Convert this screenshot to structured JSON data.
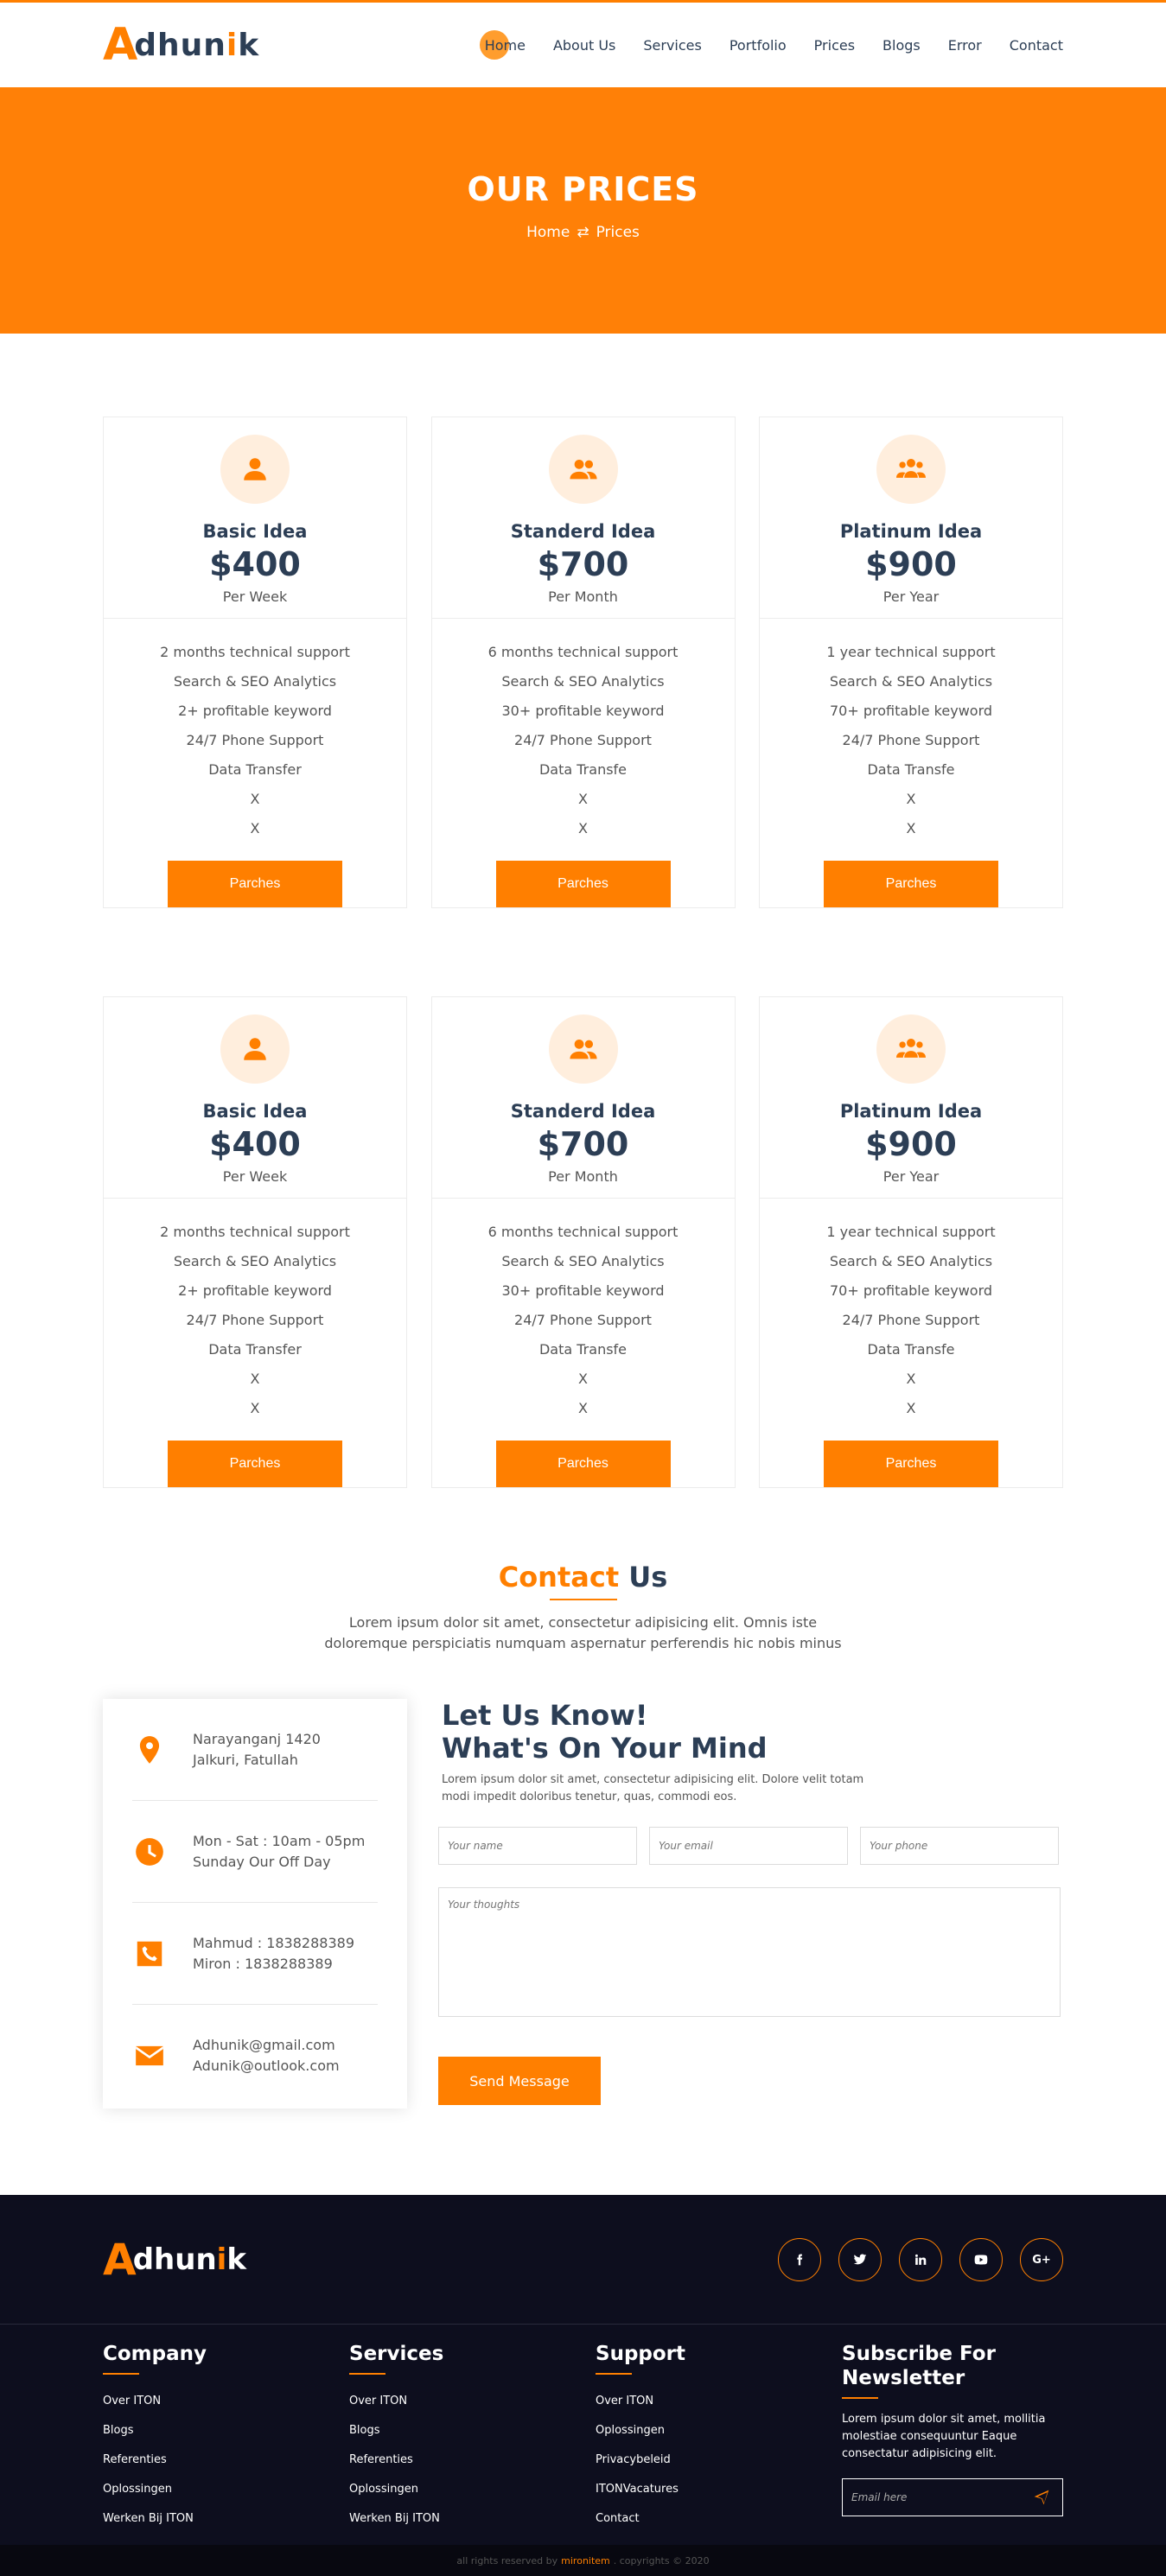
{
  "brand": {
    "first": "A",
    "middle": "dhun",
    "accent": "i",
    "last": "k"
  },
  "nav": [
    "Home",
    "About Us",
    "Services",
    "Portfolio",
    "Prices",
    "Blogs",
    "Error",
    "Contact"
  ],
  "hero": {
    "title": "OUR PRICES",
    "crumb_home": "Home",
    "crumb_sep": "⇄",
    "crumb_current": "Prices"
  },
  "pricing_rows": [
    [
      {
        "name": "Basic Idea",
        "price": "$400",
        "period": "Per Week",
        "icon": "user-icon",
        "features": [
          "2 months technical support",
          "Search & SEO Analytics",
          "2+ profitable keyword",
          "24/7 Phone Support",
          "Data Transfer",
          "X",
          "X"
        ],
        "button": "Parches"
      },
      {
        "name": "Standerd Idea",
        "price": "$700",
        "period": "Per Month",
        "icon": "users-icon",
        "features": [
          "6 months technical support",
          "Search & SEO Analytics",
          "30+ profitable keyword",
          "24/7 Phone Support",
          "Data Transfe",
          "X",
          "X"
        ],
        "button": "Parches"
      },
      {
        "name": "Platinum Idea",
        "price": "$900",
        "period": "Per Year",
        "icon": "group-icon",
        "features": [
          "1 year technical support",
          "Search & SEO Analytics",
          "70+ profitable keyword",
          "24/7 Phone Support",
          "Data Transfe",
          "X",
          "X"
        ],
        "button": "Parches"
      }
    ],
    [
      {
        "name": "Basic Idea",
        "price": "$400",
        "period": "Per Week",
        "icon": "user-icon",
        "features": [
          "2 months technical support",
          "Search & SEO Analytics",
          "2+ profitable keyword",
          "24/7 Phone Support",
          "Data Transfer",
          "X",
          "X"
        ],
        "button": "Parches"
      },
      {
        "name": "Standerd Idea",
        "price": "$700",
        "period": "Per Month",
        "icon": "users-icon",
        "features": [
          "6 months technical support",
          "Search & SEO Analytics",
          "30+ profitable keyword",
          "24/7 Phone Support",
          "Data Transfe",
          "X",
          "X"
        ],
        "button": "Parches"
      },
      {
        "name": "Platinum Idea",
        "price": "$900",
        "period": "Per Year",
        "icon": "group-icon",
        "features": [
          "1 year technical support",
          "Search & SEO Analytics",
          "70+ profitable keyword",
          "24/7 Phone Support",
          "Data Transfe",
          "X",
          "X"
        ],
        "button": "Parches"
      }
    ]
  ],
  "contact": {
    "title_accent": "Contact",
    "title_rest": "Us",
    "description": "Lorem ipsum dolor sit amet, consectetur adipisicing elit. Omnis iste doloremque perspiciatis numquam aspernatur perferendis hic nobis minus",
    "info": [
      {
        "icon": "map-pin-icon",
        "line1": "Narayanganj 1420",
        "line2": "Jalkuri, Fatullah"
      },
      {
        "icon": "clock-icon",
        "line1": "Mon - Sat : 10am - 05pm",
        "line2": "Sunday Our Off Day"
      },
      {
        "icon": "phone-icon",
        "line1": "Mahmud : 1838288389",
        "line2": "Miron : 1838288389"
      },
      {
        "icon": "envelope-icon",
        "line1": "Adhunik@gmail.com",
        "line2": "Adunik@outlook.com"
      }
    ],
    "form_title_1": "Let Us Know!",
    "form_title_2": "What's On Your Mind",
    "form_lead": "Lorem ipsum dolor sit amet, consectetur adipisicing elit. Dolore velit totam modi impedit doloribus tenetur, quas, commodi eos.",
    "name_placeholder": "Your name",
    "email_placeholder": "Your email",
    "phone_placeholder": "Your phone",
    "thoughts_placeholder": "Your thoughts",
    "send_label": "Send Message"
  },
  "footer": {
    "socials": [
      "f",
      "t",
      "in",
      "yt",
      "G+"
    ],
    "columns": [
      {
        "title": "Company",
        "links": [
          "Over ITON",
          "Blogs",
          "Referenties",
          "Oplossingen",
          "Werken Bij ITON"
        ]
      },
      {
        "title": "Services",
        "links": [
          "Over ITON",
          "Blogs",
          "Referenties",
          "Oplossingen",
          "Werken Bij ITON"
        ]
      },
      {
        "title": "Support",
        "links": [
          "Over ITON",
          "Oplossingen",
          "Privacybeleid",
          "ITONVacatures",
          "Contact"
        ]
      }
    ],
    "newsletter_title": "Subscribe For Newsletter",
    "newsletter_text": "Lorem ipsum dolor sit amet, mollitia molestiae consequuntur Eaque consectatur adipisicing elit.",
    "newsletter_placeholder": "Email here",
    "copy_before": "all rights reserved by",
    "copy_brand": "mironitem",
    "copy_after": ". copyrights © 2020"
  },
  "colors": {
    "accent": "#ff7f00",
    "dark": "#2c3e55",
    "footer_bg": "#0d0e1e"
  }
}
